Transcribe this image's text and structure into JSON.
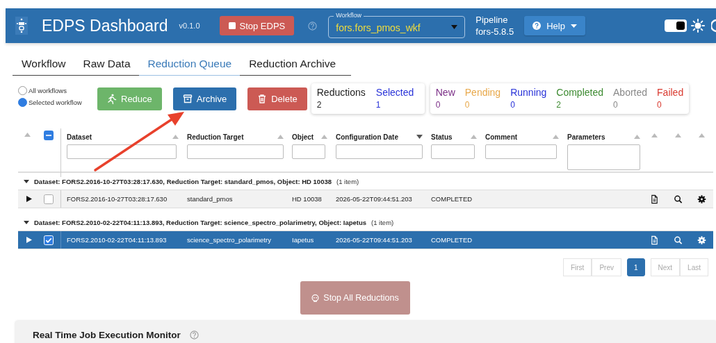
{
  "header": {
    "title": "EDPS Dashboard",
    "version": "v0.1.0",
    "stop_button": "Stop EDPS",
    "workflow_select": {
      "label": "Workflow",
      "value": "fors.fors_pmos_wkf"
    },
    "pipeline": {
      "label": "Pipeline",
      "value": "fors-5.8.5"
    },
    "help_button": "Help",
    "theme_toggle": {
      "on": true
    }
  },
  "tabs": [
    {
      "label": "Workflow",
      "selected": false
    },
    {
      "label": "Raw Data",
      "selected": false
    },
    {
      "label": "Reduction Queue",
      "selected": true
    },
    {
      "label": "Reduction Archive",
      "selected": false
    }
  ],
  "scope_options": [
    {
      "label": "All workflows",
      "selected": false
    },
    {
      "label": "Selected workflow",
      "selected": true
    }
  ],
  "action_buttons": [
    {
      "label": "Reduce",
      "kind": "reduce"
    },
    {
      "label": "Archive",
      "kind": "archive"
    },
    {
      "label": "Delete",
      "kind": "delete"
    }
  ],
  "summary_counts": [
    {
      "label": "Reductions",
      "value": "2",
      "color": "#222222"
    },
    {
      "label": "Selected",
      "value": "1",
      "color": "#2832d8"
    }
  ],
  "status_counts": [
    {
      "label": "New",
      "value": "0",
      "color": "#7a2d86"
    },
    {
      "label": "Pending",
      "value": "0",
      "color": "#e8a84a"
    },
    {
      "label": "Running",
      "value": "0",
      "color": "#2832d8"
    },
    {
      "label": "Completed",
      "value": "2",
      "color": "#3c8a30"
    },
    {
      "label": "Aborted",
      "value": "0",
      "color": "#888888"
    },
    {
      "label": "Failed",
      "value": "0",
      "color": "#d93a30"
    }
  ],
  "table": {
    "select_all_partial": true,
    "columns": [
      {
        "kind": "expander",
        "sort_descending": false
      },
      {
        "kind": "data",
        "label": "Dataset",
        "sort_descending": false,
        "multiline": false
      },
      {
        "kind": "data",
        "label": "Reduction Target",
        "sort_descending": false,
        "multiline": false
      },
      {
        "kind": "data",
        "label": "Object",
        "sort_descending": false,
        "multiline": false
      },
      {
        "kind": "data",
        "label": "Configuration Date",
        "sort_descending": true,
        "multiline": false
      },
      {
        "kind": "data",
        "label": "Status",
        "sort_descending": false,
        "multiline": false
      },
      {
        "kind": "data",
        "label": "Comment",
        "sort_descending": false,
        "multiline": false
      },
      {
        "kind": "data",
        "label": "Parameters",
        "sort_descending": false,
        "multiline": true
      },
      {
        "kind": "action",
        "sort_descending": false
      },
      {
        "kind": "action",
        "sort_descending": false
      },
      {
        "kind": "action",
        "sort_descending": false
      }
    ],
    "groups": [
      {
        "label": "Dataset: FORS2.2016-10-27T03:28:17.630, Reduction Target: standard_pmos, Object: HD 10038",
        "count": "(1 item)",
        "expanded": true,
        "rows": [
          {
            "cells": [
              "FORS2.2016-10-27T03:28:17.630",
              "standard_pmos",
              "HD 10038",
              "2026-05-22T09:44:51.203",
              "COMPLETED"
            ],
            "selected": false
          }
        ]
      },
      {
        "label": "Dataset: FORS2.2010-02-22T04:11:13.893, Reduction Target: science_spectro_polarimetry, Object: Iapetus",
        "count": "(1 item)",
        "expanded": true,
        "rows": [
          {
            "cells": [
              "FORS2.2010-02-22T04:11:13.893",
              "science_spectro_polarimetry",
              "Iapetus",
              "2026-05-22T09:44:51.203",
              "COMPLETED"
            ],
            "selected": true
          }
        ]
      }
    ]
  },
  "pagination": [
    {
      "label": "First",
      "selected": false,
      "disabled": true
    },
    {
      "label": "Prev",
      "selected": false,
      "disabled": true
    },
    {
      "label": "1",
      "selected": true,
      "disabled": false
    },
    {
      "label": "Next",
      "selected": false,
      "disabled": true
    },
    {
      "label": "Last",
      "selected": false,
      "disabled": true
    }
  ],
  "stop_all_button": {
    "label": "Stop All Reductions",
    "disabled": true
  },
  "monitor_panel": {
    "title": "Real Time Job Execution Monitor"
  }
}
